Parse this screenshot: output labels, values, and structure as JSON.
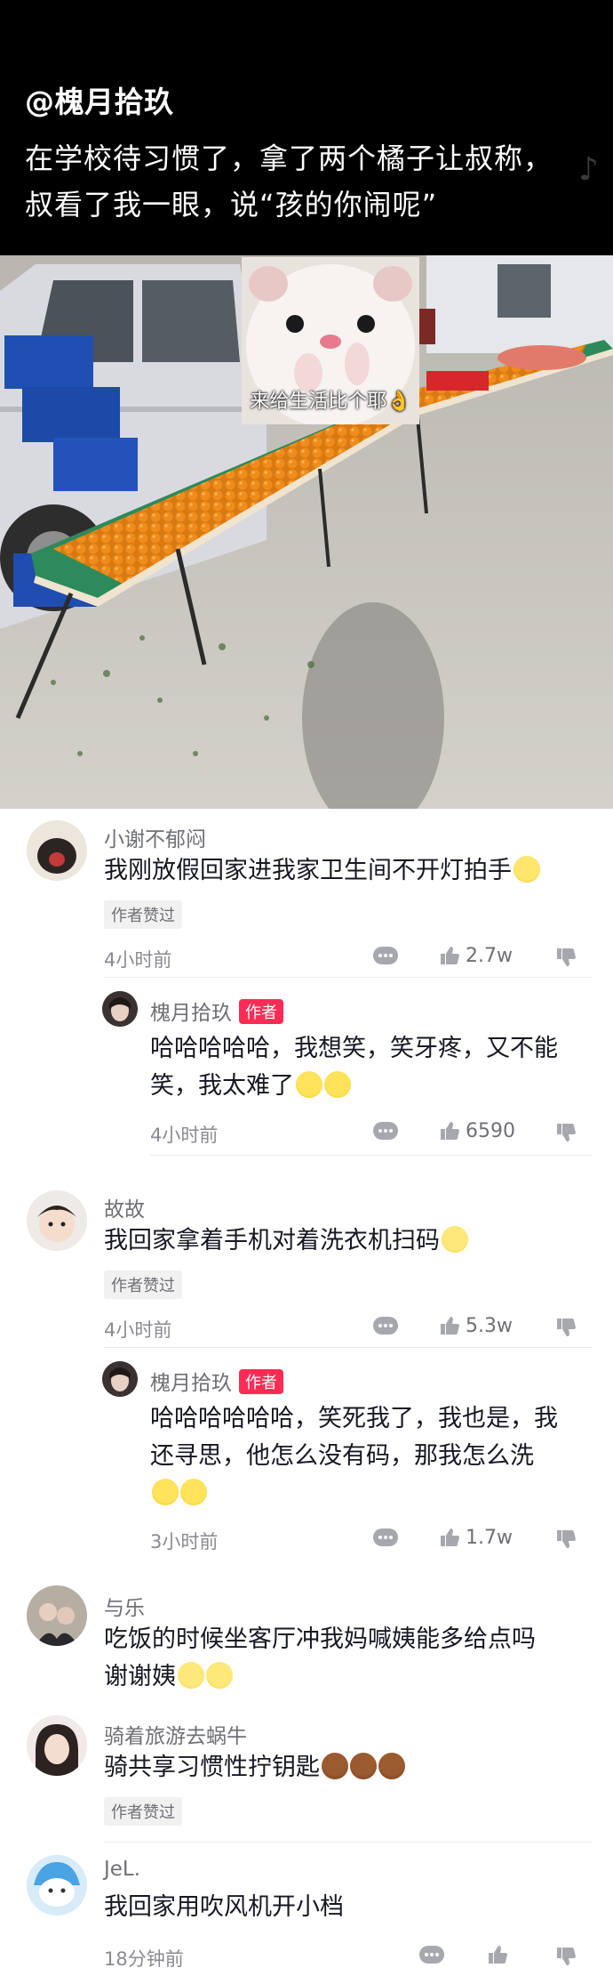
{
  "post": {
    "author_handle": "@槐月拾玖",
    "caption": "在学校待习惯了，拿了两个橘子让叔称，叔看了我一眼，说“孩的你闹呢”",
    "sticker_text": "来给生活比个耶👌"
  },
  "comments": [
    {
      "username": "小谢不郁闷",
      "text": "我刚放假回家进我家卫生间不开灯拍手",
      "emoji": "awk",
      "liked_tag": "作者赞过",
      "time": "4小时前",
      "likes": "2.7w",
      "reply": {
        "username": "槐月拾玖",
        "badge": "作者",
        "text_line1": "哈哈哈哈哈，我想笑，笑牙疼，又不能",
        "text_line2": "笑，我太难了",
        "time": "4小时前",
        "likes": "6590"
      }
    },
    {
      "username": "故故",
      "text": "我回家拿着手机对着洗衣机扫码",
      "liked_tag": "作者赞过",
      "time": "4小时前",
      "likes": "5.3w",
      "reply": {
        "username": "槐月拾玖",
        "badge": "作者",
        "text_line1": "哈哈哈哈哈哈，笑死我了，我也是，我",
        "text_line2": "还寻思，他怎么没有码，那我怎么洗",
        "time": "3小时前",
        "likes": "1.7w"
      }
    },
    {
      "username": "与乐",
      "text_line1": "吃饭的时候坐客厅冲我妈喊姨能多给点吗",
      "text_line2": "谢谢姨"
    },
    {
      "username": "骑着旅游去蜗牛",
      "text": "骑共享习惯性拧钥匙",
      "liked_tag": "作者赞过"
    },
    {
      "username": "JeL.",
      "text": "我回家用吹风机开小档",
      "time": "18分钟前"
    }
  ],
  "colors": {
    "author_badge": "#fe2c55",
    "header_bg": "#000000"
  }
}
